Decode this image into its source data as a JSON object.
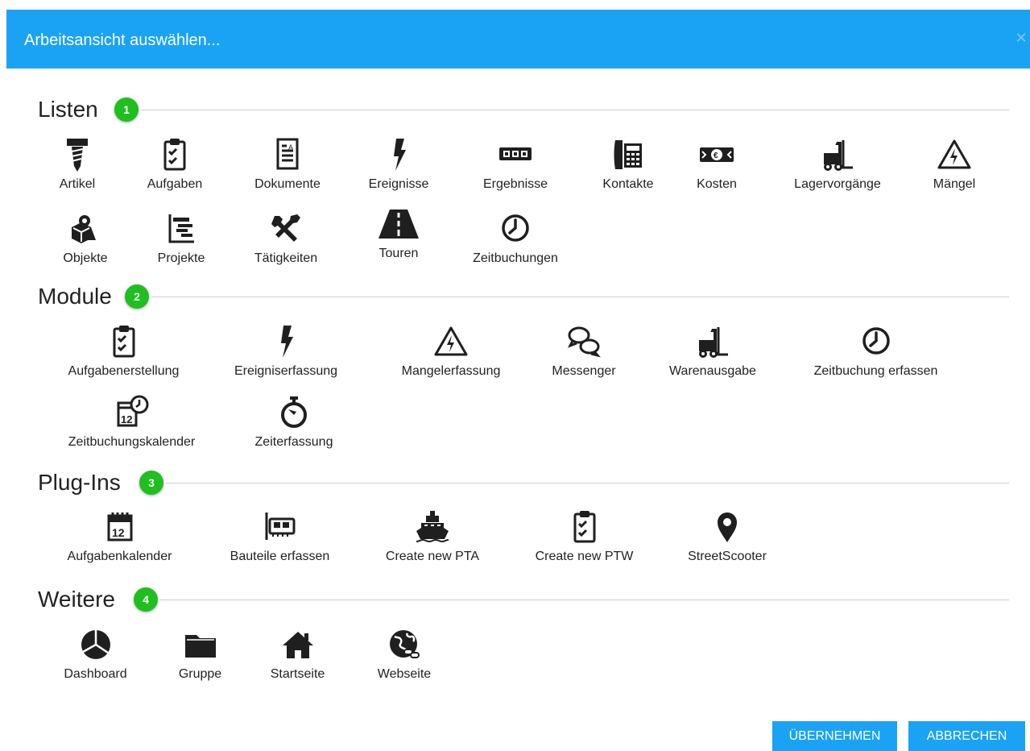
{
  "dialog": {
    "title": "Arbeitsansicht auswählen...",
    "close_icon": "close-icon"
  },
  "sections": {
    "listen": {
      "title": "Listen",
      "badge": "1",
      "items": [
        "Artikel",
        "Aufgaben",
        "Dokumente",
        "Ereignisse",
        "Ergebnisse",
        "Kontakte",
        "Kosten",
        "Lagervorgänge",
        "Mängel",
        "Objekte",
        "Projekte",
        "Tätigkeiten",
        "Touren",
        "Zeitbuchungen"
      ]
    },
    "module": {
      "title": "Module",
      "badge": "2",
      "items": [
        "Aufgabenerstellung",
        "Ereigniserfassung",
        "Mangelerfassung",
        "Messenger",
        "Warenausgabe",
        "Zeitbuchung erfassen",
        "Zeitbuchungskalender",
        "Zeiterfassung"
      ]
    },
    "plugins": {
      "title": "Plug-Ins",
      "badge": "3",
      "items": [
        "Aufgabenkalender",
        "Bauteile erfassen",
        "Create new PTA",
        "Create new PTW",
        "StreetScooter"
      ]
    },
    "weitere": {
      "title": "Weitere",
      "badge": "4",
      "items": [
        "Dashboard",
        "Gruppe",
        "Startseite",
        "Webseite"
      ]
    }
  },
  "footer": {
    "apply_label": "ÜBERNEHMEN",
    "cancel_label": "ABBRECHEN"
  },
  "colors": {
    "header": "#1aa3f4",
    "badge": "#1fbf1f",
    "icon": "#1f1f1f"
  }
}
